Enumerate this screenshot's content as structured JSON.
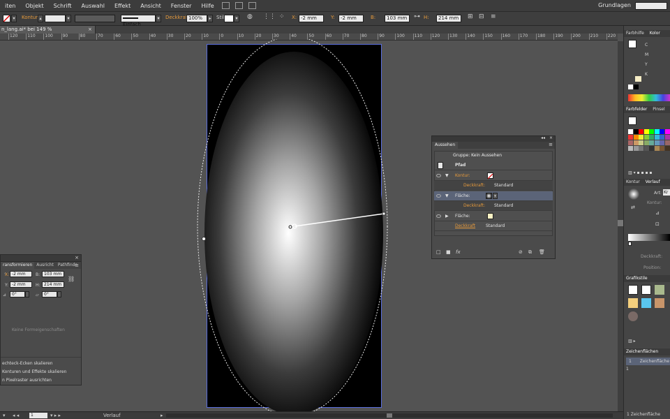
{
  "menu": {
    "items": [
      "iten",
      "Objekt",
      "Schrift",
      "Auswahl",
      "Effekt",
      "Ansicht",
      "Fenster",
      "Hilfe"
    ],
    "workspace": "Grundlagen"
  },
  "control_bar": {
    "kontur_label": "Kontur:",
    "stroke_style": "Einfach",
    "deckkraft_label": "Deckkraft:",
    "deckkraft_value": "100%",
    "stil_label": "Stil:",
    "x_label": "X:",
    "x_value": "-2 mm",
    "y_label": "Y:",
    "y_value": "-2 mm",
    "b_label": "B:",
    "b_value": "103 mm",
    "h_label": "H:",
    "h_value": "214 mm"
  },
  "document": {
    "tab_title": "n_lang.ai* bei 149 % (CMYK/Vorschau)"
  },
  "ruler": {
    "ticks": [
      "120",
      "110",
      "100",
      "90",
      "80",
      "70",
      "60",
      "50",
      "40",
      "30",
      "20",
      "10",
      "0",
      "10",
      "20",
      "30",
      "40",
      "50",
      "60",
      "70",
      "80",
      "90",
      "100",
      "110",
      "120",
      "130",
      "140",
      "150",
      "160",
      "170",
      "180",
      "190",
      "200",
      "210",
      "220",
      "230"
    ]
  },
  "status": {
    "zoom": "1",
    "tool": "Verlauf"
  },
  "transform_panel": {
    "tabs": [
      "ransformieren",
      "Ausricht",
      "Pathfindr"
    ],
    "x_label": "X:",
    "x_value": "-2 mm",
    "y_label": "Y:",
    "y_value": "-2 mm",
    "b_label": "B:",
    "b_value": "103 mm",
    "h_label": "H:",
    "h_value": "214 mm",
    "angle_value": "0°",
    "shear_value": "0°",
    "no_shape_text": "Keine Formeigenschaften",
    "options": [
      "echteck-Ecken skalieren",
      "Konturen und Effekte skalieren",
      "n Pixelraster ausrichten"
    ]
  },
  "appearance_panel": {
    "tab": "Aussehen",
    "group_title": "Gruppe: Kein Aussehen",
    "rows": [
      {
        "label": "Pfad",
        "sub": ""
      },
      {
        "label": "Kontur:",
        "sub": ""
      },
      {
        "label": "Deckkraft:",
        "sub": "Standard"
      },
      {
        "label": "Fläche:",
        "sub": ""
      },
      {
        "label": "Deckkraft:",
        "sub": "Standard"
      },
      {
        "label": "Fläche:",
        "sub": ""
      },
      {
        "label": "Deckkraft",
        "sub": "Standard"
      }
    ]
  },
  "dock": {
    "color_tabs": [
      "Farbhilfe",
      "Kolor"
    ],
    "cmyk": [
      "C",
      "M",
      "Y",
      "K"
    ],
    "swatches_tabs": [
      "Farbfelder",
      "Pinsel"
    ],
    "gradient_tabs": [
      "Kontur",
      "Verlauf"
    ],
    "gradient_type_label": "Art:",
    "gradient_type_value": "Kr",
    "gradient_stroke_label": "Kontur:",
    "gradient_opacity_label": "Deckkraft:",
    "gradient_position_label": "Position:",
    "graphic_styles_tab": "Grafikstile",
    "artboards_tab": "Zeichenflächen",
    "artboard_number": "1",
    "artboard_name": "Zeichenfläche 1",
    "artboard_count": "1 Zeichenfläche"
  },
  "colors": {
    "accent_orange": "#e69a3c",
    "selection_blue": "#5a6ee0",
    "panel_bg": "#4b4b4b",
    "canvas_bg": "#535353"
  }
}
